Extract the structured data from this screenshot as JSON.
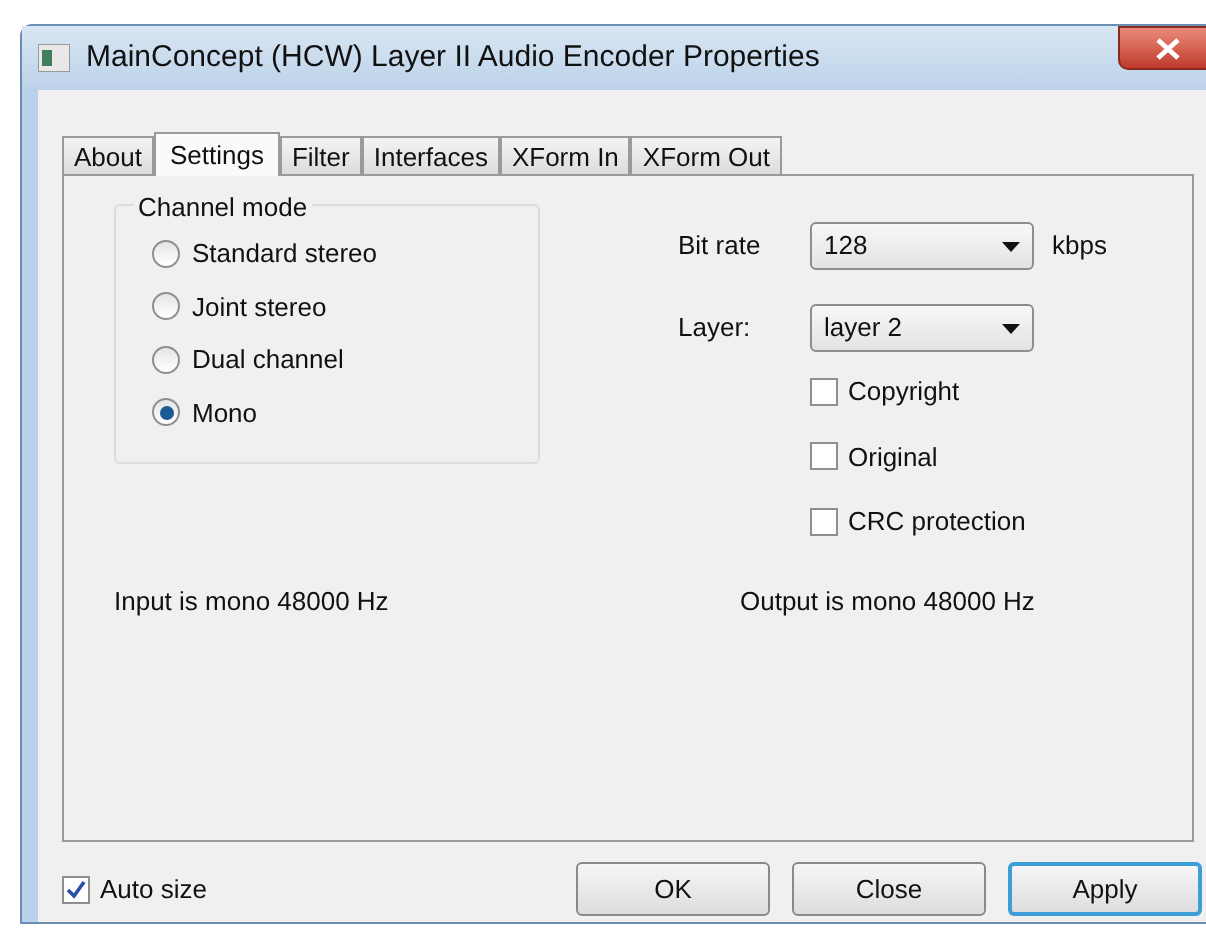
{
  "window": {
    "title": "MainConcept (HCW) Layer II Audio Encoder Properties"
  },
  "tabs": [
    {
      "label": "About",
      "selected": false
    },
    {
      "label": "Settings",
      "selected": true
    },
    {
      "label": "Filter",
      "selected": false
    },
    {
      "label": "Interfaces",
      "selected": false
    },
    {
      "label": "XForm In",
      "selected": false
    },
    {
      "label": "XForm Out",
      "selected": false
    }
  ],
  "channel_mode": {
    "title": "Channel mode",
    "options": [
      {
        "label": "Standard stereo",
        "selected": false
      },
      {
        "label": "Joint stereo",
        "selected": false
      },
      {
        "label": "Dual channel",
        "selected": false
      },
      {
        "label": "Mono",
        "selected": true
      }
    ]
  },
  "bit_rate": {
    "label": "Bit rate",
    "value": "128",
    "unit": "kbps"
  },
  "layer": {
    "label": "Layer:",
    "value": "layer 2"
  },
  "checkboxes": [
    {
      "label": "Copyright",
      "checked": false
    },
    {
      "label": "Original",
      "checked": false
    },
    {
      "label": "CRC protection",
      "checked": false
    }
  ],
  "input_info": "Input is mono 48000 Hz",
  "output_info": "Output is mono 48000 Hz",
  "auto_size": {
    "label": "Auto size",
    "checked": true
  },
  "buttons": [
    {
      "label": "OK",
      "default": false
    },
    {
      "label": "Close",
      "default": false
    },
    {
      "label": "Apply",
      "default": true
    }
  ]
}
